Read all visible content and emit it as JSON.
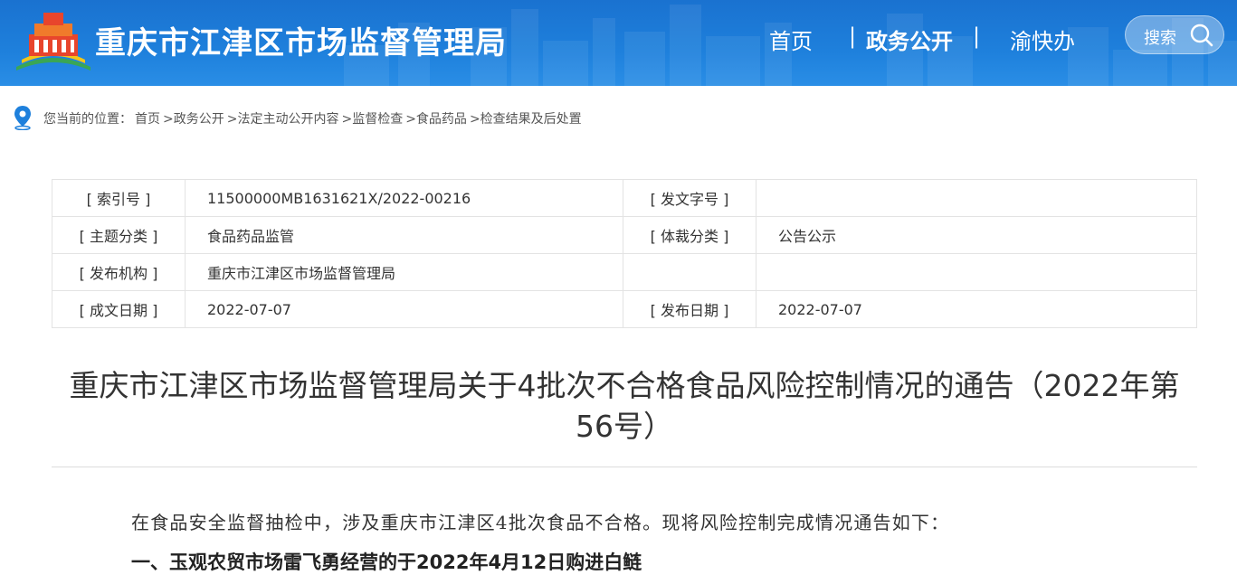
{
  "header": {
    "site_title": "重庆市江津区市场监督管理局",
    "nav": {
      "home": "首页",
      "separator": "|",
      "gov_affairs": "政务公开",
      "yu_kuai_ban": "渝快办"
    },
    "search_label": "搜索",
    "colors": {
      "bg": "#1e80dc",
      "text": "#ffffff"
    }
  },
  "breadcrumb": {
    "prefix": "您当前的位置：",
    "items": [
      "首页",
      ">政务公开",
      ">法定主动公开内容",
      ">监督检查",
      ">食品药品",
      ">检查结果及后处置"
    ]
  },
  "meta": {
    "rows": [
      {
        "k1": "[ 索引号 ]",
        "v1": "11500000MB1631621X/2022-00216",
        "k2": "[ 发文字号 ]",
        "v2": ""
      },
      {
        "k1": "[ 主题分类 ]",
        "v1": "食品药品监管",
        "k2": "[ 体裁分类 ]",
        "v2": "公告公示"
      },
      {
        "k1": "[ 发布机构 ]",
        "v1": "重庆市江津区市场监督管理局",
        "k2": "",
        "v2": ""
      },
      {
        "k1": "[ 成文日期 ]",
        "v1": "2022-07-07",
        "k2": "[ 发布日期 ]",
        "v2": "2022-07-07"
      }
    ]
  },
  "document": {
    "title_line1": "重庆市江津区市场监督管理局关于4批次不合格食品风险控制情况的通告（2022年第",
    "title_line2": "56号）",
    "intro": "在食品安全监督抽检中，涉及重庆市江津区4批次食品不合格。现将风险控制完成情况通告如下：",
    "section1": "一、玉观农贸市场雷飞勇经营的于2022年4月12日购进白鲢"
  }
}
